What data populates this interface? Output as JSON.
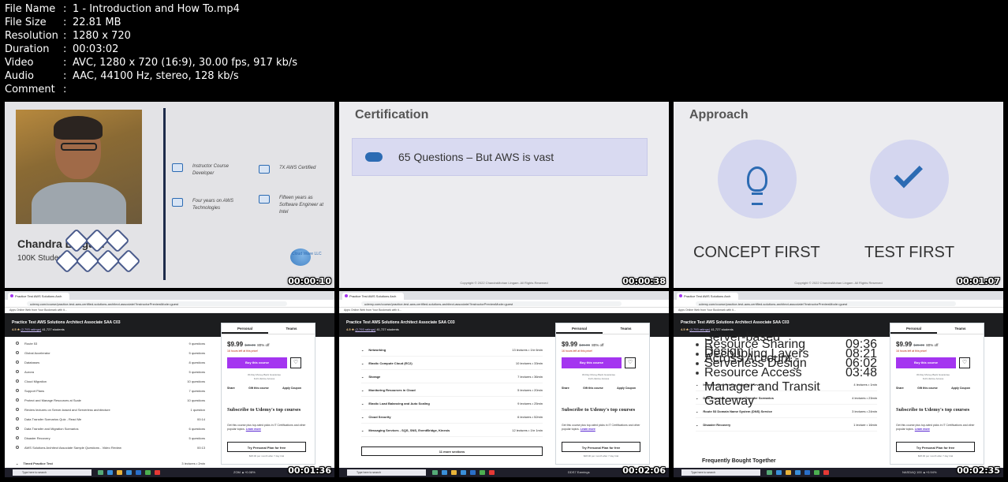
{
  "meta": [
    {
      "label": "File Name",
      "value": "1 - Introduction and How To.mp4"
    },
    {
      "label": "File Size",
      "value": "22.81 MB"
    },
    {
      "label": "Resolution",
      "value": "1280 x 720"
    },
    {
      "label": "Duration",
      "value": "00:03:02"
    },
    {
      "label": "Video",
      "value": "AVC, 1280 x 720 (16:9), 30.00 fps, 917 kb/s"
    },
    {
      "label": "Audio",
      "value": "AAC, 44100 Hz, stereo, 128 kb/s"
    },
    {
      "label": "Comment",
      "value": ""
    }
  ],
  "timestamps": [
    "00:00:10",
    "00:00:38",
    "00:01:07",
    "00:01:36",
    "00:02:06",
    "00:02:35"
  ],
  "slide1": {
    "name": "Chandra Lingam",
    "students": "100K Students",
    "facts": [
      {
        "text": "Instructor Course Developer",
        "icon": "person-icon"
      },
      {
        "text": "7X AWS Certified",
        "icon": "check-icon"
      },
      {
        "text": "Four years on AWS Technologies",
        "icon": "cloud-icon"
      },
      {
        "text": "Fifteen years as Software Engineer at Intel",
        "icon": "user-icon"
      }
    ],
    "logo_text": "Cloud Wave LLC"
  },
  "slide2": {
    "title": "Certification",
    "box_text": "65 Questions – But AWS is vast",
    "copyright": "Copyright © 2022 ChandraMohan Lingam. All Rights Reserved"
  },
  "slide3": {
    "title": "Approach",
    "left_caption": "CONCEPT FIRST",
    "right_caption": "TEST FIRST",
    "copyright": "Copyright © 2022 ChandraMohan Lingam. All Rights Reserved"
  },
  "browser": {
    "tab_title": "Practice Test AWS Solutions Arch",
    "url": "udemy.com/course/practice-test-aws-certified-solutions-architect-associate/?instructorPreviewMode=guest",
    "bookmarks": "Apps   Online Web from   Your Bookmark with it...",
    "course_title": "Practice Test AWS Solutions Architect Associate SAA C03",
    "rating": "4.5 ★",
    "ratings_link": "(2,793 ratings)",
    "students": "41,727 students",
    "card": {
      "tab_personal": "Personal",
      "tab_teams": "Teams",
      "price": "$9.99",
      "old_price": "$49.99",
      "discount": "80% off",
      "hours_left": "16 hours left at this price!",
      "buy": "Buy this course",
      "guarantee": "30-Day Money-Back Guarantee",
      "lifetime": "Full Lifetime Access",
      "share": "Share",
      "gift": "Gift this course",
      "coupon": "Apply Coupon",
      "sub_heading": "Subscribe to Udemy's top courses",
      "sub_text": "Get this course plus top-rated picks in IT Certifications and other popular topics.",
      "learn_more": "Learn more",
      "plan": "Try Personal Plan for free",
      "per_month": "$28.00 per month after 7 day trial"
    },
    "taskbar_search": "Type here to search"
  },
  "thumb4": {
    "items": [
      {
        "label": "Route 53",
        "count": "9 questions"
      },
      {
        "label": "Global Accelerator",
        "count": "5 questions"
      },
      {
        "label": "Databases",
        "count": "8 questions"
      },
      {
        "label": "Aurora",
        "count": "5 questions"
      },
      {
        "label": "Cloud Migration",
        "count": "10 questions"
      },
      {
        "label": "Support Plans",
        "count": "7 questions"
      },
      {
        "label": "Protect and Manage Resources at Scale",
        "count": "10 questions"
      },
      {
        "label": "Review lectures on Server-based and Serverless architecture",
        "count": "1 question"
      },
      {
        "label": "Data Transfer Scenarios Quiz - Read Me",
        "count": "00:14"
      },
      {
        "label": "Data Transfer and Migration Scenarios",
        "count": "6 questions"
      },
      {
        "label": "Disaster Recovery",
        "count": "5 questions"
      },
      {
        "label": "AWS Solutions Architect Associate Sample Questions - Video Review",
        "count": "00:13"
      }
    ],
    "section": "Timed Practice Test",
    "section_meta": "3 lectures • 2min",
    "ticker": "ZOM ▲+0.08%"
  },
  "thumb5": {
    "sections": [
      {
        "label": "Networking",
        "meta": "13 lectures • 1hr 6min"
      },
      {
        "label": "Elastic Compute Cloud (EC2)",
        "meta": "10 lectures • 33min"
      },
      {
        "label": "Storage",
        "meta": "7 lectures • 36min"
      },
      {
        "label": "Monitoring Resources in Cloud",
        "meta": "5 lectures • 20min"
      },
      {
        "label": "Elastic Load Balancing and Auto Scaling",
        "meta": "9 lectures • 25min"
      },
      {
        "label": "Cloud Security",
        "meta": "6 lectures • 52min"
      },
      {
        "label": "Messaging Services - SQS, SNS, EventBridge, Kinesis",
        "meta": "12 lectures • 1hr 1min"
      }
    ],
    "more": "11 more sections",
    "ticker": "DDS7  Earnings"
  },
  "thumb6": {
    "items": [
      {
        "label": "Server-based Design",
        "count": "09:36"
      },
      {
        "label": "Decoupling Layers",
        "count": "08:21"
      },
      {
        "label": "Serverless Design",
        "count": "06:02"
      },
      {
        "label": "Resource Sharing Across Account - Resource Access Manager and Transit Gateway",
        "count": "03:48"
      }
    ],
    "sections": [
      {
        "label": "Infrastructure, Pricing, Support - Review",
        "meta": "4 lectures • 1min"
      },
      {
        "label": "Data Migration, Incremental Transfer Scenarios",
        "meta": "4 lectures • 23min"
      },
      {
        "label": "Route 53 Domain Name System (DNS) Service",
        "meta": "3 lectures • 24min"
      },
      {
        "label": "Disaster Recovery",
        "meta": "1 lecture • 16min"
      }
    ],
    "freq": "Frequently Bought Together",
    "ticker": "NASDAQ 100 ▲+0.94%"
  }
}
